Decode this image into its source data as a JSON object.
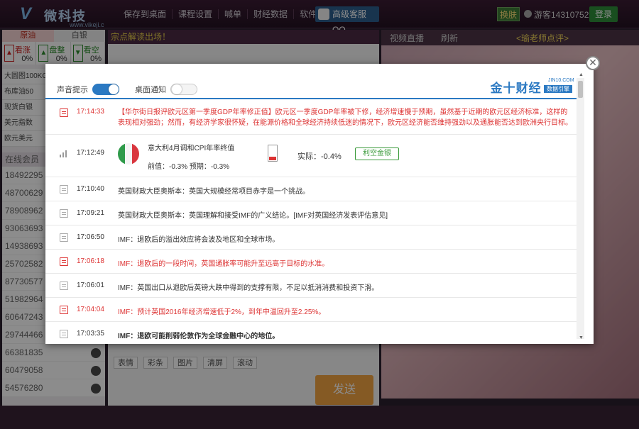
{
  "app": {
    "logo_text": "微科技",
    "logo_url": "www.vikeji.c",
    "nav": [
      "保存到桌面",
      "课程设置",
      "喊单",
      "财经数据",
      "软件下载"
    ],
    "qq_button": "高级客服QQ",
    "skin_button": "换肤",
    "user": "游客14310752",
    "login_button": "登录"
  },
  "left_panel": {
    "tabs": [
      "原油",
      "白银"
    ],
    "sentiment": [
      {
        "label": "看涨",
        "value": "0%",
        "tone": "up"
      },
      {
        "label": "盘整",
        "value": "0%",
        "tone": "flat"
      },
      {
        "label": "看空",
        "value": "0%",
        "tone": "down"
      }
    ],
    "indicators": [
      "大圆图100KG",
      "布库油50",
      "现货白银",
      "美元指数",
      "欧元美元"
    ],
    "members_header": "在线会员",
    "members": [
      "18492295",
      "48700629",
      "78908962",
      "93063693",
      "14938693",
      "25702582",
      "87730577",
      "51982964",
      "60647243",
      "29744466",
      "66381835",
      "60479058",
      "54576280"
    ]
  },
  "center": {
    "notice": "宗点解读出场！",
    "tools": [
      "表情",
      "彩条",
      "图片",
      "清屏",
      "滚动"
    ],
    "send_button": "发送"
  },
  "right": {
    "tabs": [
      "视频直播",
      "刷新"
    ],
    "title": "<瑜老师点评>"
  },
  "modal": {
    "sound_label": "声音提示",
    "sound_on": true,
    "desktop_label": "桌面通知",
    "desktop_on": false,
    "brand_main": "金十财经",
    "brand_sub": "JIN10.COM",
    "brand_sub2": "数据引擎",
    "close_glyph": "✕",
    "news": [
      {
        "type": "long",
        "red": true,
        "bold": false,
        "time": "17:14:33",
        "text": "【华尔街日报评欧元区第一季度GDP年率修正值】欧元区一季度GDP年率被下修，经济增速慢于预期，虽然基于近期的欧元区经济标准，这样的表现相对强劲；然而，有经济学家很怀疑，在能源价格和全球经济持续低迷的情况下，欧元区经济能否维持强劲以及通胀能否达到欧洲央行目标。"
      },
      {
        "type": "data",
        "time": "17:12:49",
        "title": "意大利4月调和CPI年率终值",
        "previous": "前值：-0.3% 预期：-0.3%",
        "actual": "实际：-0.4%",
        "impact": "利空金银",
        "actual_level": 0.25
      },
      {
        "type": "short",
        "red": false,
        "bold": false,
        "time": "17:10:40",
        "text": "英国财政大臣奥斯本：英国大规模经常项目赤字是一个挑战。"
      },
      {
        "type": "short",
        "red": false,
        "bold": false,
        "time": "17:09:21",
        "text": "英国财政大臣奥斯本：英国理解和接受IMF的广义结论。[IMF对英国经济发表评估意见]"
      },
      {
        "type": "short",
        "red": false,
        "bold": false,
        "time": "17:06:50",
        "text": "IMF：退欧后的溢出效应将会波及地区和全球市场。"
      },
      {
        "type": "short",
        "red": true,
        "bold": false,
        "time": "17:06:18",
        "text": "IMF：退欧后的一段时间，英国通胀率可能升至远高于目标的水准。"
      },
      {
        "type": "short",
        "red": false,
        "bold": false,
        "time": "17:06:01",
        "text": "IMF：英国出口从退欧后英镑大跌中得到的支撑有限，不足以抵消消费和投资下滑。"
      },
      {
        "type": "short",
        "red": true,
        "bold": false,
        "time": "17:04:04",
        "text": "IMF：预计英国2016年经济增速低于2%，到年中温回升至2.25%。"
      },
      {
        "type": "short",
        "red": false,
        "bold": true,
        "time": "17:03:35",
        "text": "IMF：退欧可能削弱伦敦作为全球金融中心的地位。"
      }
    ],
    "colors": {
      "accent": "#2b79c2",
      "alert": "#dd3333",
      "bullish": "#3a9a3a"
    }
  }
}
